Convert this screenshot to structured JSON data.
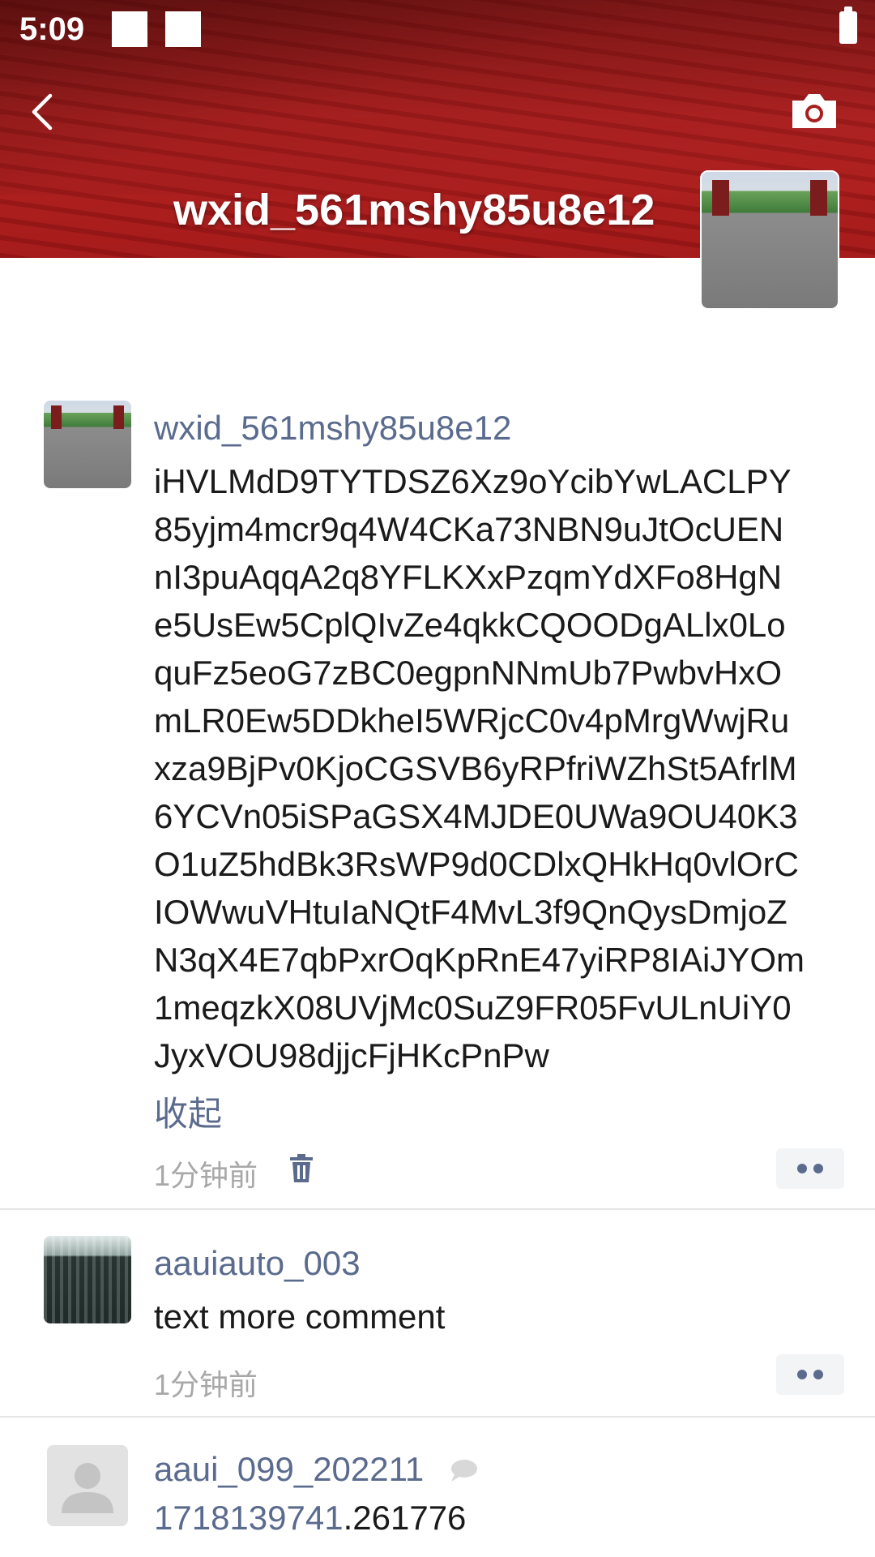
{
  "status_bar": {
    "time": "5:09"
  },
  "cover": {
    "name": "wxid_561mshy85u8e12"
  },
  "posts": [
    {
      "author": "wxid_561mshy85u8e12",
      "lines": [
        "iHVLMdD9TYTDSZ6Xz9oYcibYwLACLPY",
        "85yjm4mcr9q4W4CKa73NBN9uJtOcUEN",
        "nI3puAqqA2q8YFLKXxPzqmYdXFo8HgN",
        "e5UsEw5CplQIvZe4qkkCQOODgALlx0Lo",
        "quFz5eoG7zBC0egpnNNmUb7PwbvHxO",
        "mLR0Ew5DDkheI5WRjcC0v4pMrgWwjRu",
        "xza9BjPv0KjoCGSVB6yRPfriWZhSt5AfrlM",
        "6YCVn05iSPaGSX4MJDE0UWa9OU40K3",
        "O1uZ5hdBk3RsWP9d0CDlxQHkHq0vlOrC",
        "IOWwuVHtuIaNQtF4MvL3f9QnQysDmjoZ",
        "N3qX4E7qbPxrOqKpRnE47yiRP8IAiJYOm",
        "1meqzkX08UVjMc0SuZ9FR05FvULnUiY0",
        "JyxVOU98djjcFjHKcPnPw"
      ],
      "collapse_label": "收起",
      "time": "1分钟前"
    },
    {
      "author": "aauiauto_003",
      "text": "text more comment",
      "time": "1分钟前"
    },
    {
      "author": "aaui_099_202211",
      "link_text": "1718139741",
      "suffix_text": ".261776"
    }
  ]
}
